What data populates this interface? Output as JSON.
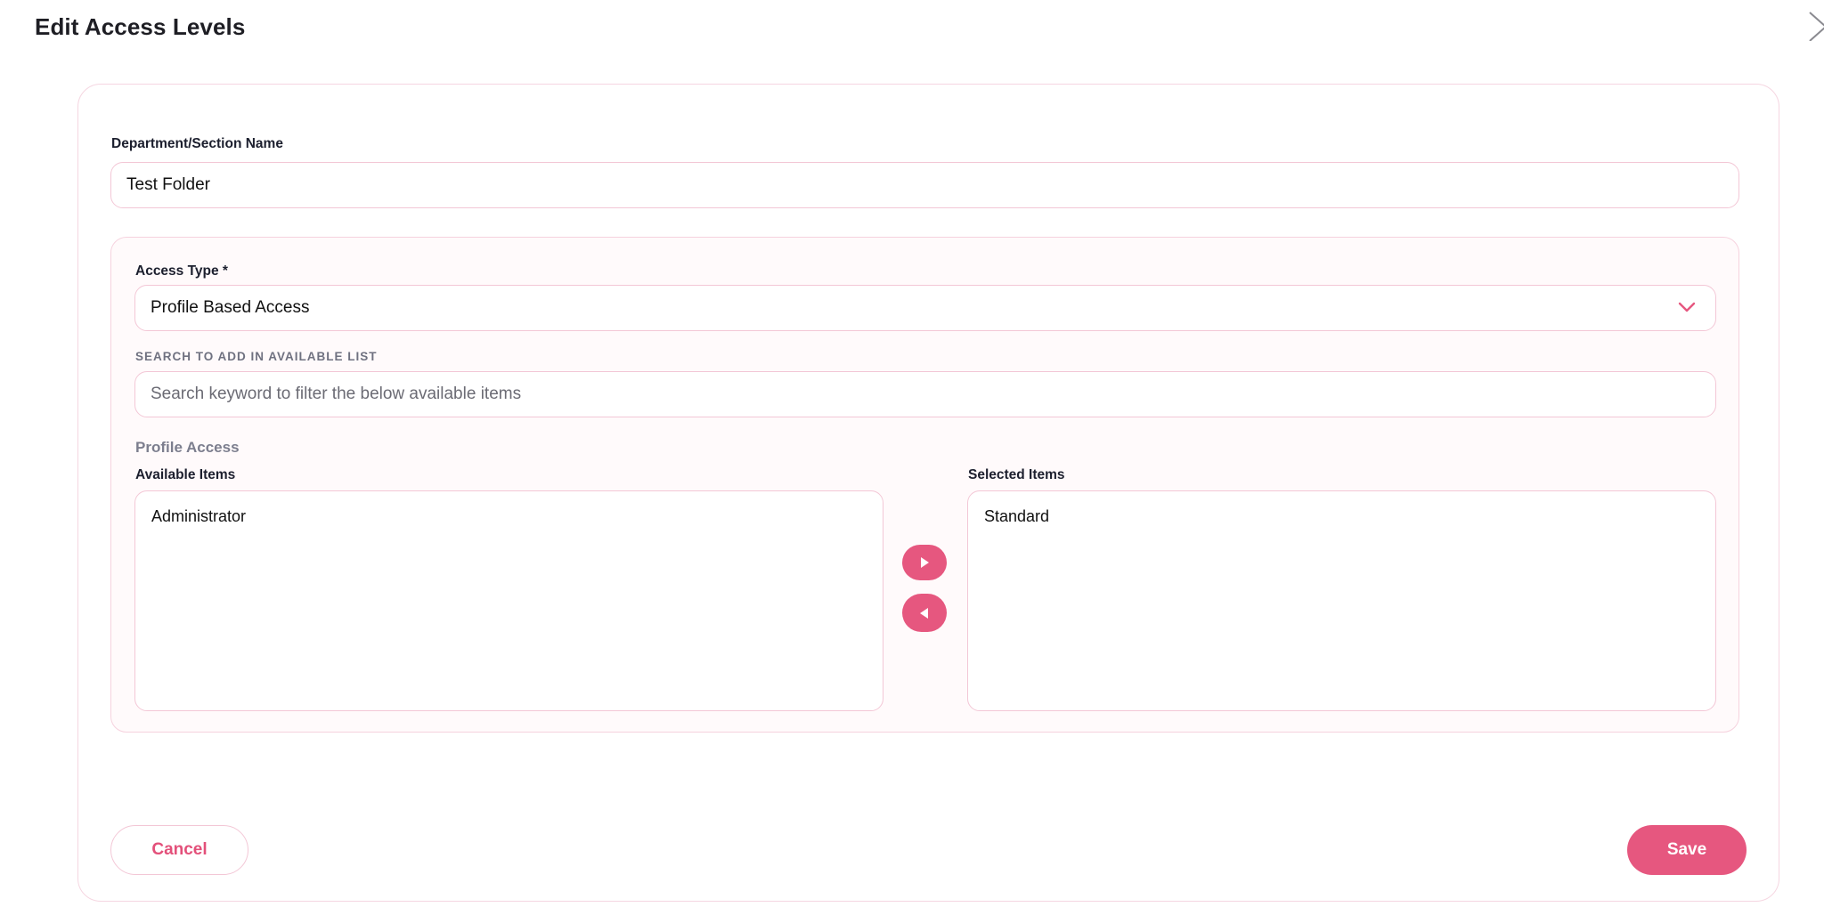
{
  "modal": {
    "title": "Edit Access Levels",
    "close_icon": "close-icon"
  },
  "form": {
    "department_label": "Department/Section Name",
    "department_value": "Test Folder",
    "access_type_label": "Access Type *",
    "access_type_value": "Profile Based Access",
    "access_type_icon": "chevron-down-icon",
    "search_label": "SEARCH TO ADD IN AVAILABLE LIST",
    "search_value": "",
    "search_placeholder": "Search keyword to filter the below available items",
    "section_title": "Profile Access",
    "available_label": "Available Items",
    "selected_label": "Selected Items",
    "available_items": [
      "Administrator"
    ],
    "selected_items": [
      "Standard"
    ],
    "move_right_icon": "play-right-icon",
    "move_left_icon": "play-left-icon"
  },
  "footer": {
    "cancel_label": "Cancel",
    "save_label": "Save"
  },
  "colors": {
    "accent": "#e6577f",
    "border": "#f3c7d6",
    "panel_bg": "#fffafb",
    "title_text": "#1e1e24",
    "muted_label": "#7c7e8e"
  }
}
